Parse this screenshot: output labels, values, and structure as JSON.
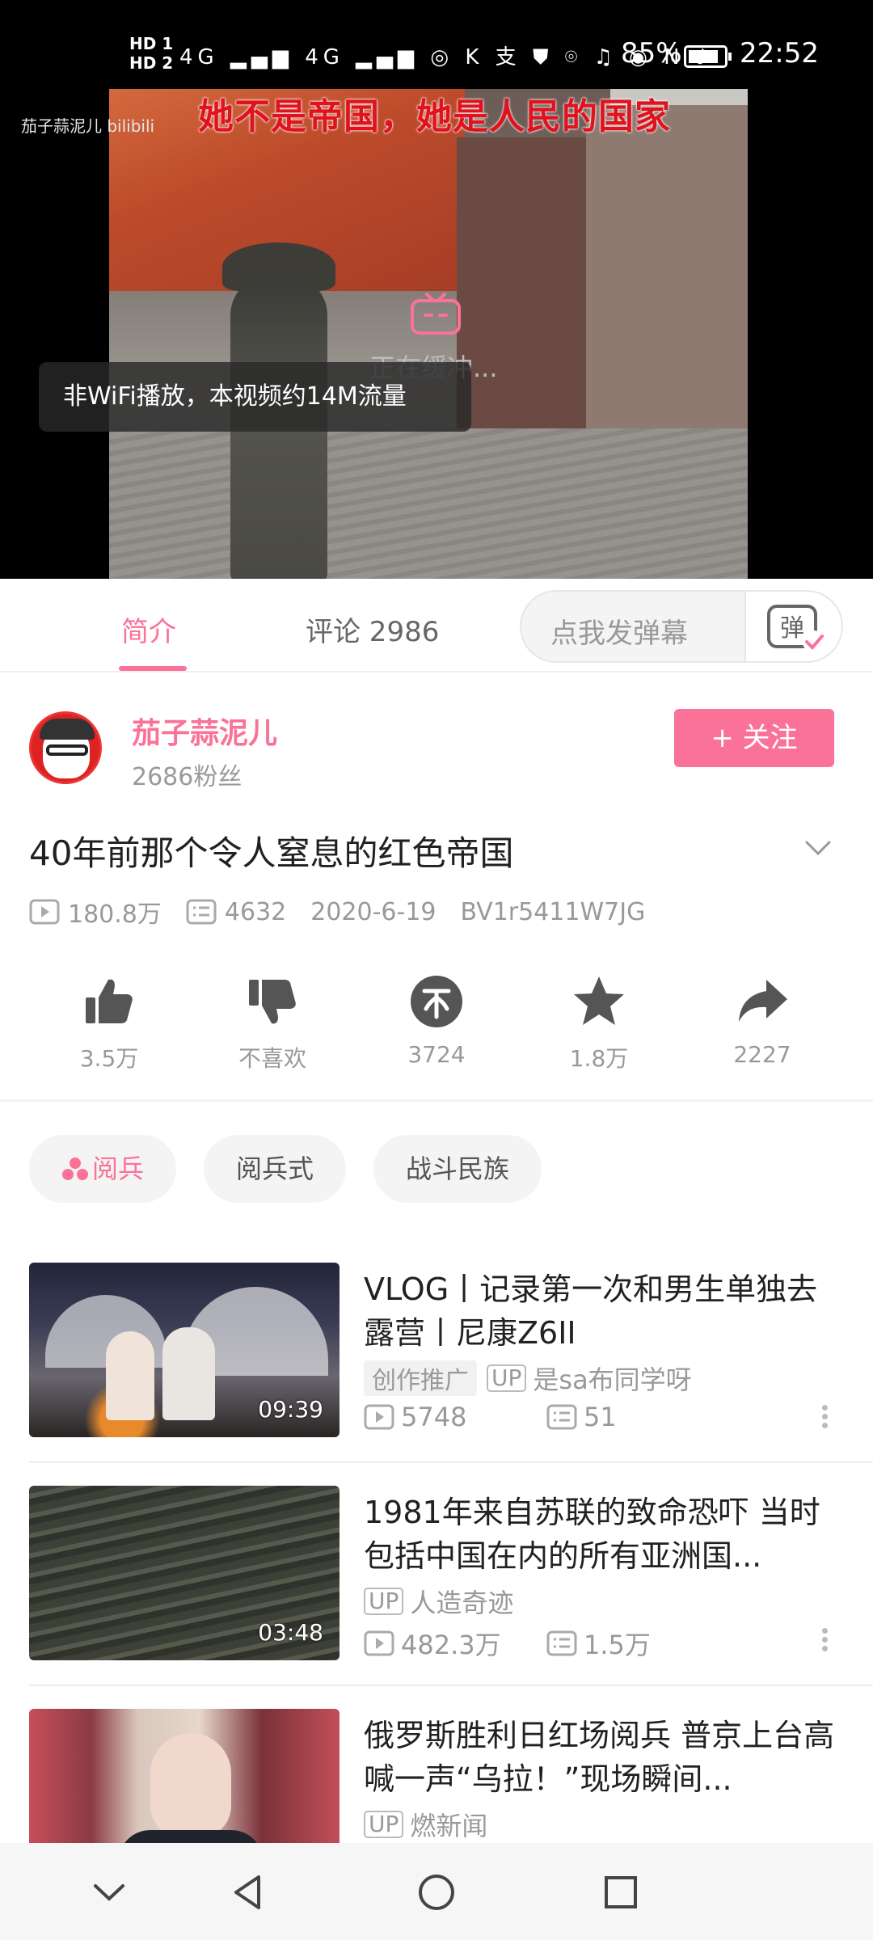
{
  "status_bar": {
    "sim": "HD 1\nHD 2",
    "signal_icons": "4G ▂▄▆ 4G ▂▄▆ ◎ K 支 ⛊ ⌾ ♫ ◉ N ♪",
    "battery": "85%",
    "battery_level": 0.85,
    "time": "22:52"
  },
  "video": {
    "subtitle": "她不是帝国，她是人民的国家",
    "watermark": "茄子蒜泥儿 bilibili",
    "buffering": "正在缓冲...",
    "toast": "非WiFi播放，本视频约14M流量"
  },
  "tabs": {
    "intro": "简介",
    "comments": "评论 2986",
    "danmaku_placeholder": "点我发弹幕",
    "danmaku_button": "弹"
  },
  "uploader": {
    "name": "茄子蒜泥儿",
    "fans": "2686粉丝",
    "follow": "+ 关注"
  },
  "video_info": {
    "title": "40年前那个令人窒息的红色帝国",
    "views": "180.8万",
    "danmaku": "4632",
    "date": "2020-6-19",
    "bvid": "BV1r5411W7JG"
  },
  "actions": {
    "like": "3.5万",
    "dislike": "不喜欢",
    "coin": "3724",
    "favorite": "1.8万",
    "share": "2227"
  },
  "tags": [
    "阅兵",
    "阅兵式",
    "战斗民族"
  ],
  "recommendations": [
    {
      "title": "VLOG丨记录第一次和男生单独去露营丨尼康Z6II",
      "promo": "创作推广",
      "author": "是sa布同学呀",
      "views": "5748",
      "danmaku": "51",
      "duration": "09:39"
    },
    {
      "title": "1981年来自苏联的致命恐吓 当时包括中国在内的所有亚洲国...",
      "author": "人造奇迹",
      "views": "482.3万",
      "danmaku": "1.5万",
      "duration": "03:48"
    },
    {
      "title": "俄罗斯胜利日红场阅兵 普京上台高喊一声“乌拉！”现场瞬间...",
      "author": "燃新闻"
    }
  ],
  "badges": {
    "up": "UP"
  },
  "colors": {
    "accent": "#fb7299",
    "subtitle": "#e0121e"
  }
}
